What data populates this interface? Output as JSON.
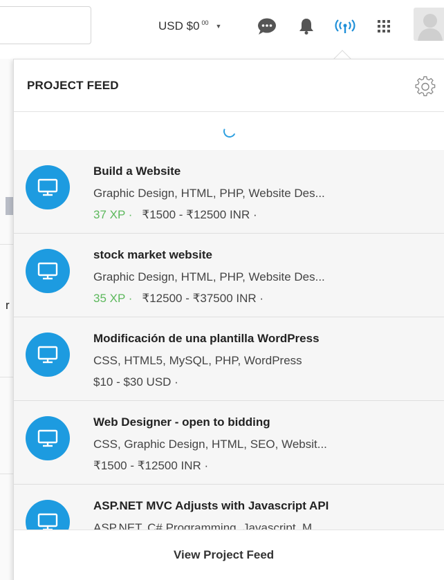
{
  "topbar": {
    "balance_main": "USD $0",
    "balance_cents": "00",
    "caret": "▼"
  },
  "popup": {
    "title": "PROJECT FEED",
    "footer_link": "View Project Feed"
  },
  "feed_items": [
    {
      "title": "Build a Website",
      "skills": "Graphic Design, HTML, PHP, Website Des...",
      "xp": "37 XP ·",
      "budget": "₹1500 - ₹12500 INR ·"
    },
    {
      "title": "stock market website",
      "skills": "Graphic Design, HTML, PHP, Website Des...",
      "xp": "35 XP ·",
      "budget": "₹12500 - ₹37500 INR ·"
    },
    {
      "title": "Modificación de una plantilla WordPress",
      "skills": "CSS, HTML5, MySQL, PHP, WordPress",
      "xp": "",
      "budget": "$10 - $30 USD ·"
    },
    {
      "title": "Web Designer - open to bidding",
      "skills": "CSS, Graphic Design, HTML, SEO, Websit...",
      "xp": "",
      "budget": "₹1500 - ₹12500 INR ·"
    },
    {
      "title": "ASP.NET MVC Adjusts with Javascript API",
      "skills": "ASP.NET, C# Programming, Javascript, M...",
      "xp": "",
      "budget": ""
    }
  ],
  "colors": {
    "accent": "#1d9be0",
    "xp": "#5cb85c",
    "feed_active": "#1e8fd8"
  },
  "icons": [
    "chat-icon",
    "bell-icon",
    "feed-icon",
    "grid-icon",
    "settings-icon",
    "monitor-icon"
  ]
}
